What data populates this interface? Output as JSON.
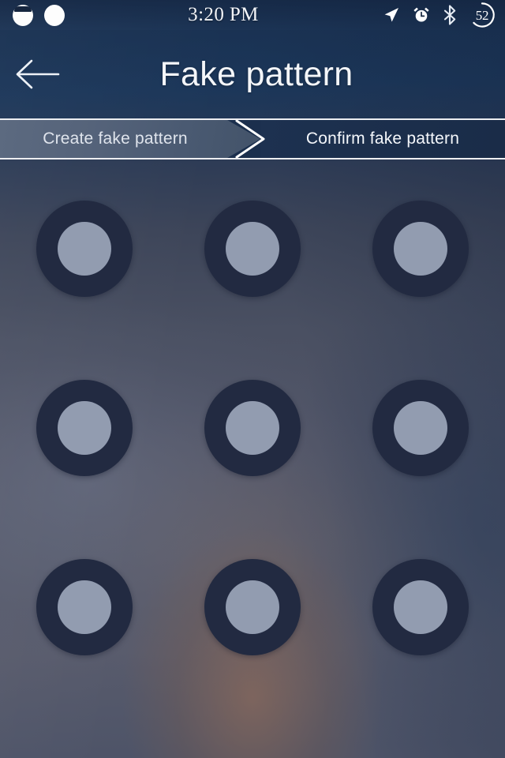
{
  "status_bar": {
    "time": "3:20 PM",
    "battery_level": "52",
    "notifications": [
      {
        "icon": "notification-circle-capped-icon"
      },
      {
        "icon": "notification-circle-icon"
      }
    ],
    "icons": [
      {
        "icon": "location-arrow-icon"
      },
      {
        "icon": "alarm-clock-icon"
      },
      {
        "icon": "bluetooth-icon"
      },
      {
        "icon": "battery-circle-icon"
      }
    ]
  },
  "header": {
    "back_icon": "back-arrow-icon",
    "title": "Fake pattern"
  },
  "steps": [
    {
      "label": "Create fake pattern",
      "active": true
    },
    {
      "label": "Confirm fake pattern",
      "active": false
    }
  ],
  "pattern": {
    "rows": 3,
    "columns": 3,
    "dots": [
      {
        "index": 1,
        "selected": false
      },
      {
        "index": 2,
        "selected": false
      },
      {
        "index": 3,
        "selected": false
      },
      {
        "index": 4,
        "selected": false
      },
      {
        "index": 5,
        "selected": false
      },
      {
        "index": 6,
        "selected": false
      },
      {
        "index": 7,
        "selected": false
      },
      {
        "index": 8,
        "selected": false
      },
      {
        "index": 9,
        "selected": false
      }
    ]
  },
  "colors": {
    "dot_ring": "#222a41",
    "dot_center": "#929cb0",
    "header_navy": "#1e3a5f",
    "step_active_bg": "#55637a",
    "step_inactive_bg": "#1b2f4d",
    "text_light": "#f4f6f9"
  }
}
